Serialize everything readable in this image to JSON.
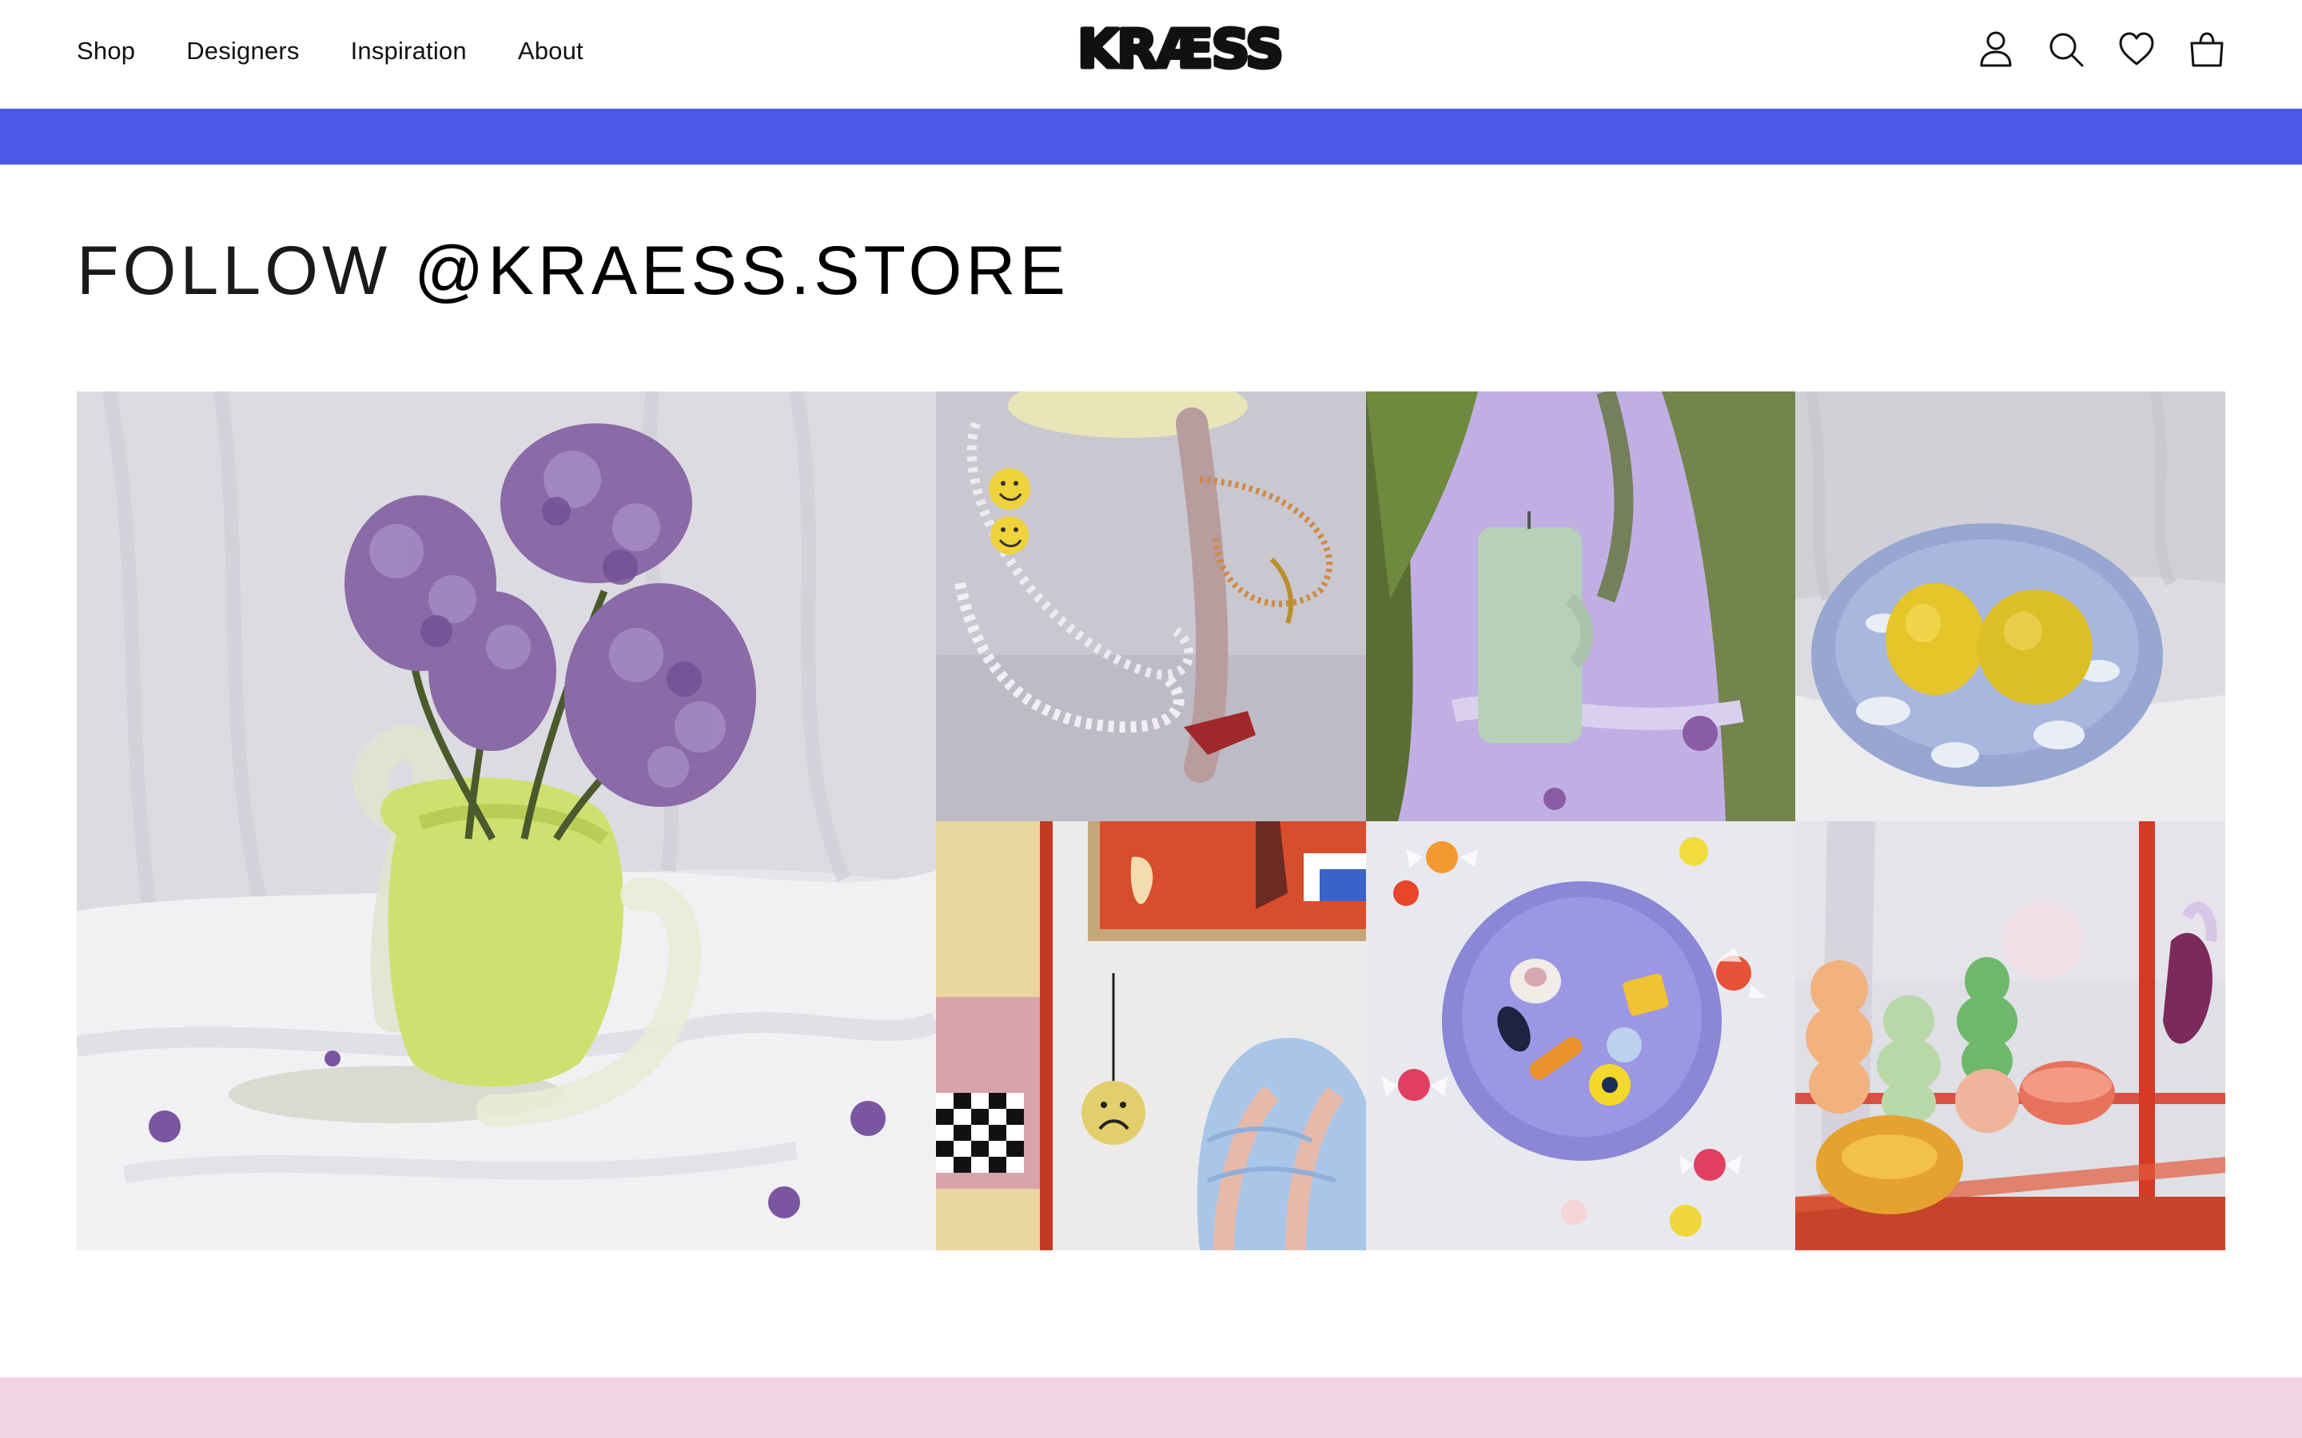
{
  "nav": {
    "items": [
      "Shop",
      "Designers",
      "Inspiration",
      "About"
    ]
  },
  "brand": {
    "logo_text": "KRÆSS"
  },
  "header_icons": [
    "account-icon",
    "search-icon",
    "wishlist-heart-icon",
    "shopping-bag-icon"
  ],
  "banner": {
    "color": "#4a5ae6"
  },
  "instagram": {
    "heading_prefix": "FOLLOW ",
    "handle": "@KRAESS.STORE",
    "feed_images": [
      "lilac-flowers-in-green-glass-vase",
      "beaded-smiley-necklaces",
      "mint-candle-on-lilac-paper",
      "lemons-on-blue-cloud-plate",
      "frowning-face-ornament-and-wall-art",
      "candies-in-purple-bowl",
      "pastel-glass-vases-on-red-shelf"
    ]
  },
  "footer_band": {
    "color": "#f2d3e1"
  }
}
